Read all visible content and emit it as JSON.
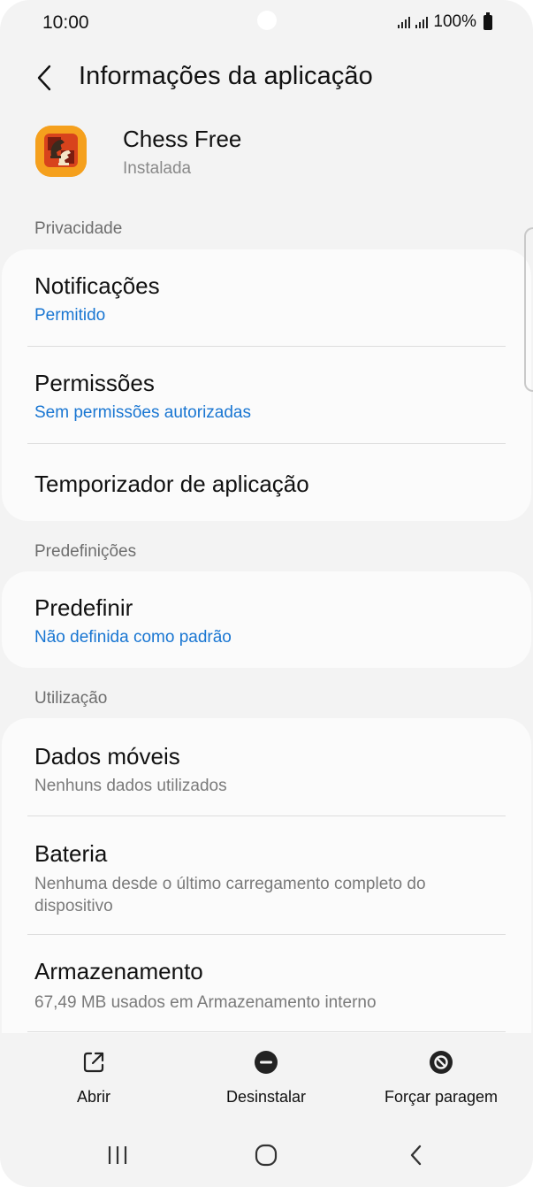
{
  "status_bar": {
    "time": "10:00",
    "battery": "100%"
  },
  "header": {
    "title": "Informações da aplicação"
  },
  "app": {
    "name": "Chess Free",
    "status": "Instalada"
  },
  "sections": {
    "privacy": {
      "label": "Privacidade",
      "items": [
        {
          "title": "Notificações",
          "subtitle": "Permitido"
        },
        {
          "title": "Permissões",
          "subtitle": "Sem permissões autorizadas"
        },
        {
          "title": "Temporizador de aplicação"
        }
      ]
    },
    "defaults": {
      "label": "Predefinições",
      "items": [
        {
          "title": "Predefinir",
          "subtitle": "Não definida como padrão"
        }
      ]
    },
    "usage": {
      "label": "Utilização",
      "items": [
        {
          "title": "Dados móveis",
          "subtitle": "Nenhuns dados utilizados"
        },
        {
          "title": "Bateria",
          "subtitle": "Nenhuma desde o último carregamento completo do dispositivo"
        },
        {
          "title": "Armazenamento",
          "subtitle": "67,49 MB usados em Armazenamento interno"
        }
      ]
    }
  },
  "actions": {
    "open": "Abrir",
    "uninstall": "Desinstalar",
    "force_stop": "Forçar paragem"
  },
  "colors": {
    "background": "#f3f3f3",
    "card": "#fbfbfb",
    "accent_blue": "#1976d2",
    "secondary_text": "#7a7a7a"
  },
  "icons": {
    "back": "back-arrow-icon",
    "open": "open-external-icon",
    "uninstall": "minus-circle-icon",
    "force_stop": "stop-circle-icon",
    "nav_recents": "recents-icon",
    "nav_home": "home-icon",
    "nav_back": "back-icon"
  }
}
